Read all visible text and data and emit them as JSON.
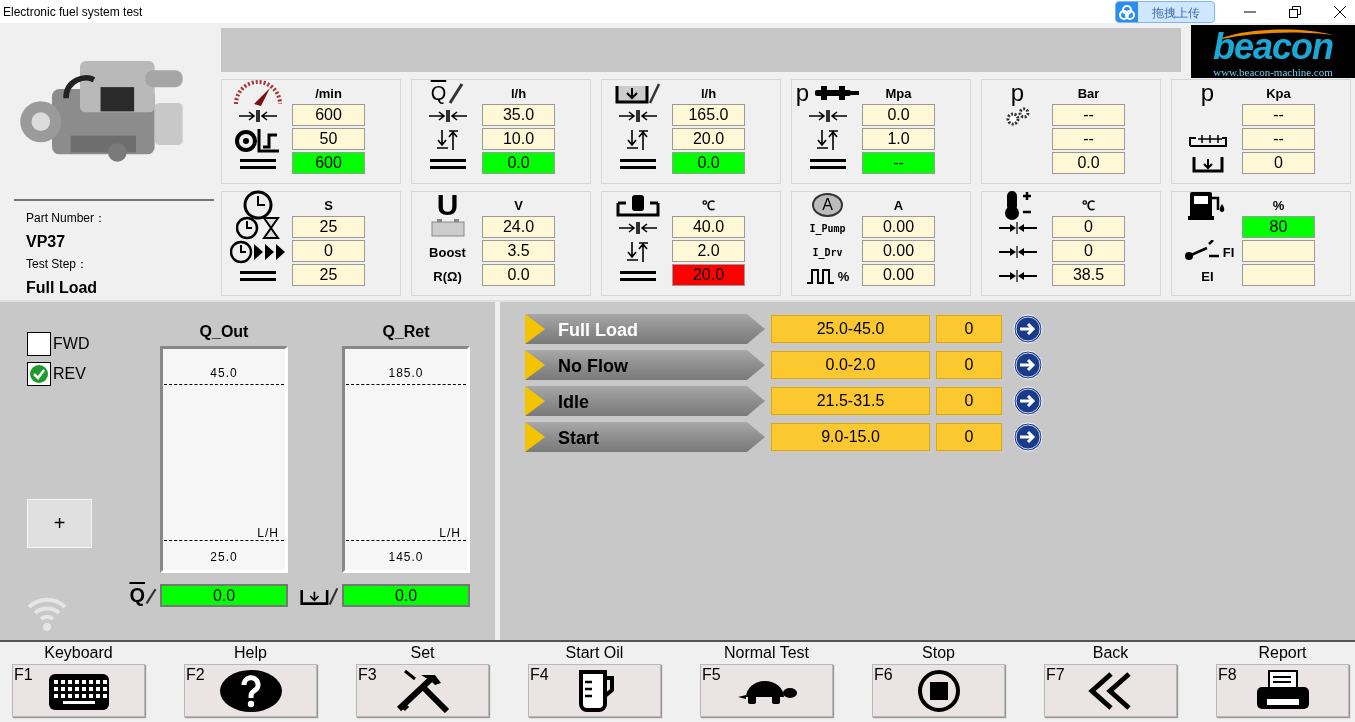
{
  "window": {
    "title": "Electronic fuel system test",
    "upload_button": "拖拽上传"
  },
  "logo": {
    "brand": "beacon",
    "url": "www.beacon-machine.com"
  },
  "part": {
    "number_label": "Part Number：",
    "number": "VP37",
    "step_label": "Test Step：",
    "step": "Full Load"
  },
  "panels": [
    {
      "unit": "/min",
      "rows": [
        {
          "value": "600",
          "color": "#fff8d6"
        },
        {
          "value": "50",
          "color": "#fff8d6"
        },
        {
          "value": "600",
          "color": "#00ff00"
        }
      ]
    },
    {
      "symbol": "Q",
      "unit": "l/h",
      "rows": [
        {
          "value": "35.0",
          "color": "#fff8d6"
        },
        {
          "value": "10.0",
          "color": "#fff8d6"
        },
        {
          "value": "0.0",
          "color": "#00ff00"
        }
      ]
    },
    {
      "unit": "l/h",
      "rows": [
        {
          "value": "165.0",
          "color": "#fff8d6"
        },
        {
          "value": "20.0",
          "color": "#fff8d6"
        },
        {
          "value": "0.0",
          "color": "#00ff00"
        }
      ]
    },
    {
      "symbol": "p",
      "unit": "Mpa",
      "rows": [
        {
          "value": "0.0",
          "color": "#fff8d6"
        },
        {
          "value": "1.0",
          "color": "#fff8d6"
        },
        {
          "value": "--",
          "color": "#00ff00"
        }
      ]
    },
    {
      "symbol": "p",
      "unit": "Bar",
      "rows": [
        {
          "value": "--",
          "color": "#fff8d6"
        },
        {
          "value": "--",
          "color": "#fff8d6"
        },
        {
          "value": "0.0",
          "color": "#fff8d6"
        }
      ]
    },
    {
      "symbol": "p",
      "unit": "Kpa",
      "rows": [
        {
          "value": "--",
          "color": "#fff8d6"
        },
        {
          "value": "--",
          "color": "#fff8d6"
        },
        {
          "value": "0",
          "color": "#fff8d6"
        }
      ]
    },
    {
      "unit": "S",
      "rows": [
        {
          "value": "25",
          "color": "#fff8d6"
        },
        {
          "value": "0",
          "color": "#fff8d6"
        },
        {
          "value": "25",
          "color": "#fff8d6"
        }
      ]
    },
    {
      "symbol": "U",
      "unit": "V",
      "rows": [
        {
          "value": "24.0",
          "color": "#fff8d6"
        },
        {
          "label": "Boost",
          "value": "3.5",
          "color": "#fff8d6"
        },
        {
          "label": "R(Ω)",
          "value": "0.0",
          "color": "#fff8d6"
        }
      ]
    },
    {
      "unit": "℃",
      "rows": [
        {
          "value": "40.0",
          "color": "#fff8d6"
        },
        {
          "value": "2.0",
          "color": "#fff8d6"
        },
        {
          "value": "20.0",
          "color": "#ff0000"
        }
      ]
    },
    {
      "symbol": "A",
      "unit": "A",
      "rows": [
        {
          "label": "I_Pump",
          "value": "0.00",
          "color": "#fff8d6"
        },
        {
          "label": "I_Drv",
          "value": "0.00",
          "color": "#fff8d6"
        },
        {
          "label": "%",
          "value": "0.00",
          "color": "#fff8d6"
        }
      ]
    },
    {
      "unit": "℃",
      "rows": [
        {
          "value": "0",
          "color": "#fff8d6"
        },
        {
          "value": "0",
          "color": "#fff8d6"
        },
        {
          "value": "38.5",
          "color": "#fff8d6"
        }
      ]
    },
    {
      "unit": "%",
      "rows": [
        {
          "value": "80",
          "color": "#00ff00"
        },
        {
          "label": "FI",
          "color": "#fff8d6"
        },
        {
          "label": "EI",
          "color": "#fff8d6"
        }
      ]
    }
  ],
  "direction": [
    {
      "label": "FWD",
      "checked": false
    },
    {
      "label": "REV",
      "checked": true
    }
  ],
  "add_button": "+",
  "meters": [
    {
      "title": "Q_Out",
      "max": "45.0",
      "min": "25.0",
      "unit": "L/H",
      "symbol": "Q",
      "reading": "0.0",
      "color": "#00ff00"
    },
    {
      "title": "Q_Ret",
      "max": "185.0",
      "min": "145.0",
      "unit": "L/H",
      "reading": "0.0",
      "color": "#00ff00"
    }
  ],
  "steps": [
    {
      "name": "Full Load",
      "range": "25.0-45.0",
      "count": "0",
      "selected": true
    },
    {
      "name": "No Flow",
      "range": "0.0-2.0",
      "count": "0",
      "selected": false
    },
    {
      "name": "Idle",
      "range": "21.5-31.5",
      "count": "0",
      "selected": false
    },
    {
      "name": "Start",
      "range": "9.0-15.0",
      "count": "0",
      "selected": false
    }
  ],
  "function_keys": [
    {
      "key": "F1",
      "label": "Keyboard"
    },
    {
      "key": "F2",
      "label": "Help"
    },
    {
      "key": "F3",
      "label": "Set"
    },
    {
      "key": "F4",
      "label": "Start Oil"
    },
    {
      "key": "F5",
      "label": "Normal Test"
    },
    {
      "key": "F6",
      "label": "Stop"
    },
    {
      "key": "F7",
      "label": "Back"
    },
    {
      "key": "F8",
      "label": "Report"
    }
  ]
}
